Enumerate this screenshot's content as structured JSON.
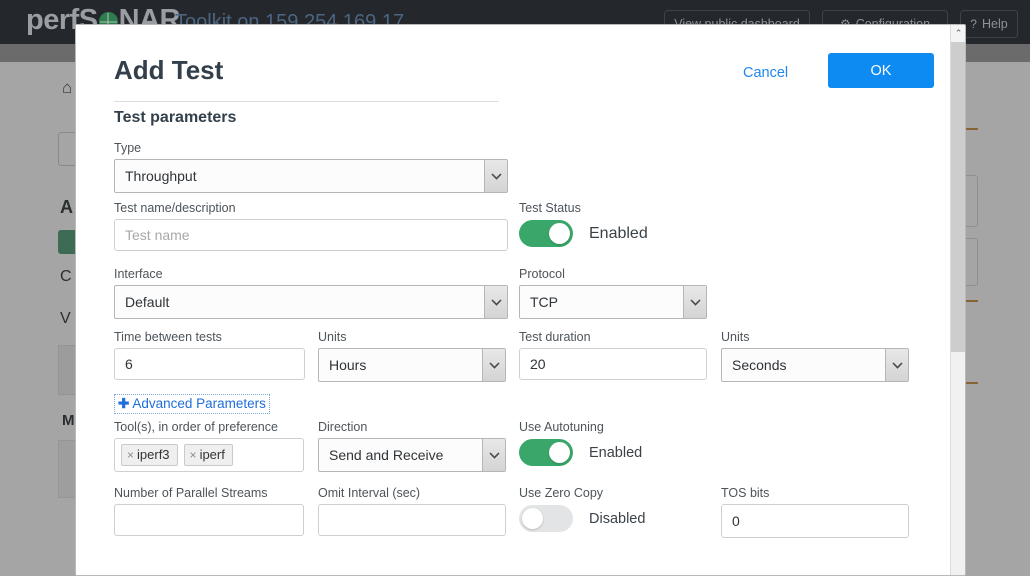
{
  "navbar": {
    "brand_prefix": "perfS",
    "brand_suffix": "NAR",
    "subtitle": "Toolkit on 159.254.169.17",
    "buttons": [
      {
        "label": "View public dashboard",
        "icon": ""
      },
      {
        "label": "Configuration",
        "icon": "⚙"
      },
      {
        "label": "Help",
        "icon": "?"
      }
    ]
  },
  "background": {
    "home_icon": "⌂",
    "letter_a": "A",
    "letter_c": "C",
    "letter_v": "V",
    "letter_m": "M"
  },
  "modal": {
    "title": "Add Test",
    "cancel_label": "Cancel",
    "ok_label": "OK",
    "section_title": "Test parameters",
    "scrollbar": {
      "up_arrow": "⌃"
    },
    "fields": {
      "type": {
        "label": "Type",
        "value": "Throughput",
        "options": [
          "Throughput"
        ]
      },
      "test_name": {
        "label": "Test name/description",
        "value": "",
        "placeholder": "Test name"
      },
      "test_status": {
        "label": "Test Status",
        "state": "Enabled",
        "on": true
      },
      "interface": {
        "label": "Interface",
        "value": "Default",
        "options": [
          "Default"
        ]
      },
      "protocol": {
        "label": "Protocol",
        "value": "TCP",
        "options": [
          "TCP"
        ]
      },
      "time_between_tests": {
        "label": "Time between tests",
        "value": "6"
      },
      "time_units": {
        "label": "Units",
        "value": "Hours",
        "options": [
          "Hours"
        ]
      },
      "test_duration": {
        "label": "Test duration",
        "value": "20"
      },
      "duration_units": {
        "label": "Units",
        "value": "Seconds",
        "options": [
          "Seconds"
        ]
      },
      "advanced_parameters": {
        "label": "Advanced Parameters",
        "plus": "✚"
      },
      "tools": {
        "label": "Tool(s), in order of preference",
        "tags": [
          "iperf3",
          "iperf"
        ],
        "remove_glyph": "×"
      },
      "direction": {
        "label": "Direction",
        "value": "Send and Receive",
        "options": [
          "Send and Receive"
        ]
      },
      "autotuning": {
        "label": "Use Autotuning",
        "state": "Enabled",
        "on": true
      },
      "parallel_streams": {
        "label": "Number of Parallel Streams",
        "value": "",
        "placeholder": ""
      },
      "omit_interval": {
        "label": "Omit Interval (sec)",
        "value": "",
        "placeholder": ""
      },
      "zero_copy": {
        "label": "Use Zero Copy",
        "state": "Disabled",
        "on": false
      },
      "tos_bits": {
        "label": "TOS bits",
        "value": "0"
      }
    }
  },
  "colors": {
    "accent_blue": "#0d8bf2",
    "link_blue": "#1e87f0",
    "toggle_on_green": "#3aa76a",
    "toggle_off_gray": "#e2e4e5",
    "navbar_dark": "#24282c"
  }
}
